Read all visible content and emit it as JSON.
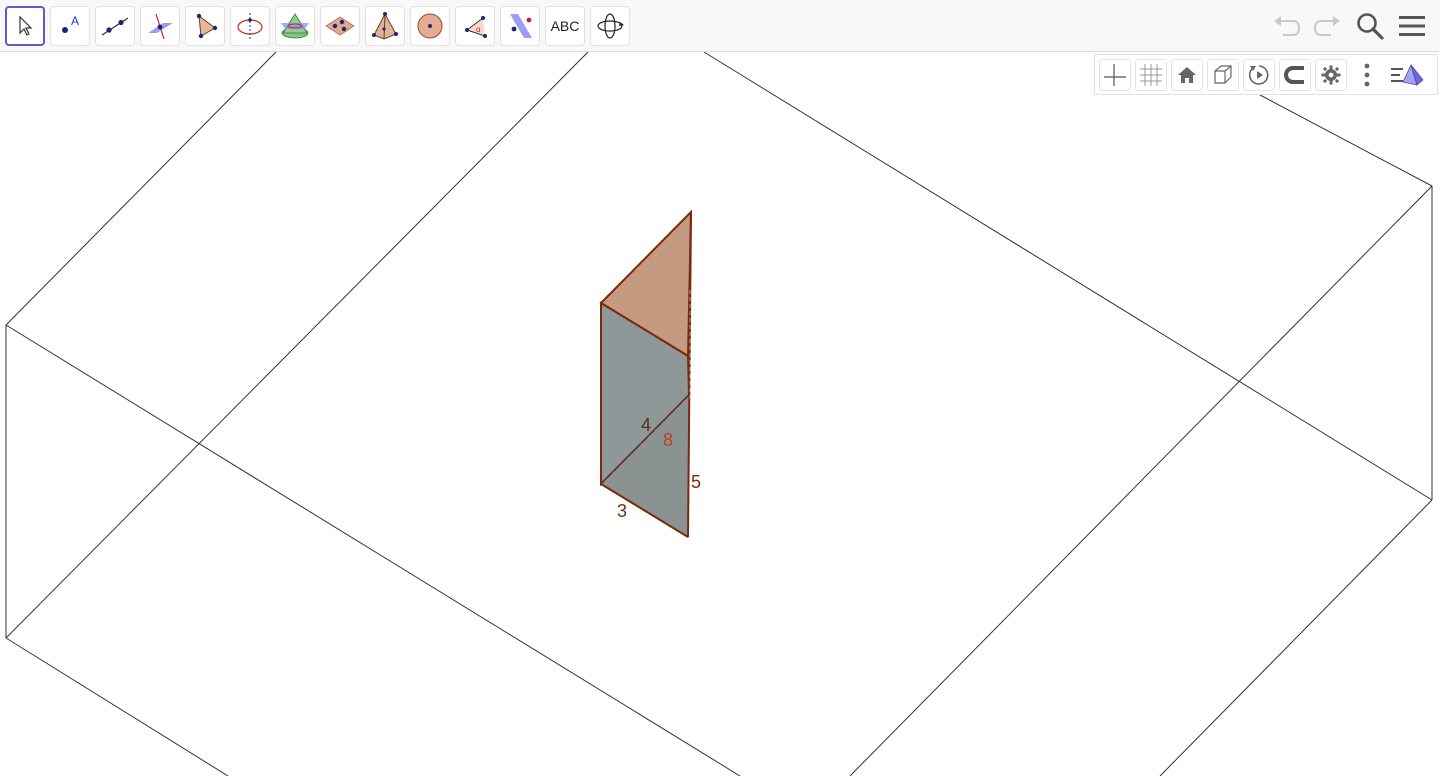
{
  "toolbar": {
    "tools": [
      {
        "name": "move",
        "icon": "arrow-cursor-icon"
      },
      {
        "name": "point",
        "icon": "point-icon"
      },
      {
        "name": "line",
        "icon": "line-icon"
      },
      {
        "name": "perpendicular-line",
        "icon": "perpendicular-line-icon"
      },
      {
        "name": "polygon",
        "icon": "polygon-icon"
      },
      {
        "name": "circle-with-axis",
        "icon": "circle-axis-icon"
      },
      {
        "name": "intersect-surfaces",
        "icon": "cone-plane-icon"
      },
      {
        "name": "plane-through-points",
        "icon": "plane-points-icon"
      },
      {
        "name": "pyramid",
        "icon": "pyramid-icon"
      },
      {
        "name": "sphere",
        "icon": "sphere-icon"
      },
      {
        "name": "angle",
        "icon": "angle-icon"
      },
      {
        "name": "reflect-about-plane",
        "icon": "reflect-plane-icon"
      },
      {
        "name": "text",
        "icon": "text-icon",
        "label": "ABC"
      },
      {
        "name": "rotate-view",
        "icon": "rotate-view-icon"
      }
    ],
    "selected_tool": "move",
    "actions": [
      "undo-icon",
      "redo-icon",
      "search-icon",
      "menu-icon"
    ]
  },
  "graphics_bar": {
    "buttons": [
      "axes-icon",
      "grid-icon",
      "home-icon",
      "cube-view-icon",
      "rotate-icon",
      "magnet-icon",
      "gear-icon",
      "more-icon",
      "style-bar-toggle-icon"
    ]
  },
  "scene": {
    "labels": {
      "edge_front_bottom": "3",
      "edge_hidden": "4",
      "edge_vertical": "5",
      "edge_diagonal": "8"
    },
    "colors": {
      "accent": "#6557d2",
      "edge": "#7a2a0a",
      "top_face": "#c49a80",
      "side_face": "#8f9898",
      "label_brown": "#7a2a0a",
      "label_orange": "#b5451b",
      "box_line": "#333333"
    }
  }
}
